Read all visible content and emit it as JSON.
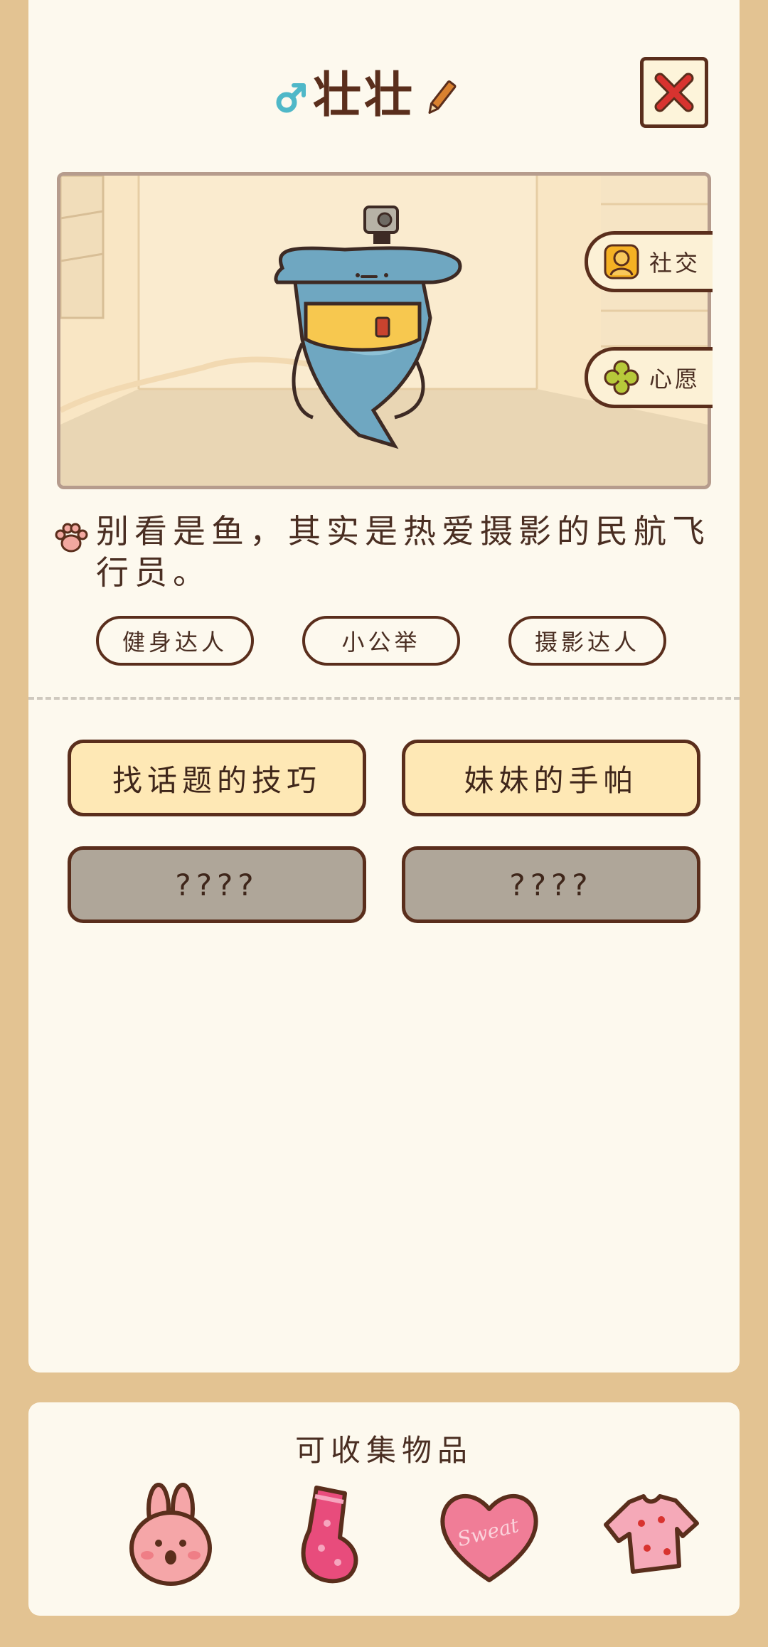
{
  "profile": {
    "name": "壮壮",
    "gender_icon": "male-symbol-icon",
    "description": "别看是鱼，其实是热爱摄影的民航飞行员。",
    "tags": [
      "健身达人",
      "小公举",
      "摄影达人"
    ]
  },
  "side_buttons": [
    {
      "label": "社交",
      "icon": "social-avatar-icon"
    },
    {
      "label": "心愿",
      "icon": "clover-icon"
    }
  ],
  "topics": [
    {
      "label": "找话题的技巧",
      "locked": false
    },
    {
      "label": "妹妹的手帕",
      "locked": false
    },
    {
      "label": "????",
      "locked": true
    },
    {
      "label": "????",
      "locked": true
    }
  ],
  "collectibles": {
    "title": "可收集物品",
    "items": [
      "bunny-face-icon",
      "pink-sock-icon",
      "sweat-heart-icon",
      "strawberry-shirt-icon"
    ],
    "heart_text": "Sweat"
  },
  "colors": {
    "background": "#E3C392",
    "card": "#FDF9EE",
    "outline": "#5A2E1C",
    "option_open": "#FEE8B5",
    "option_locked": "#AFA699",
    "gender": "#4FB8C8"
  }
}
